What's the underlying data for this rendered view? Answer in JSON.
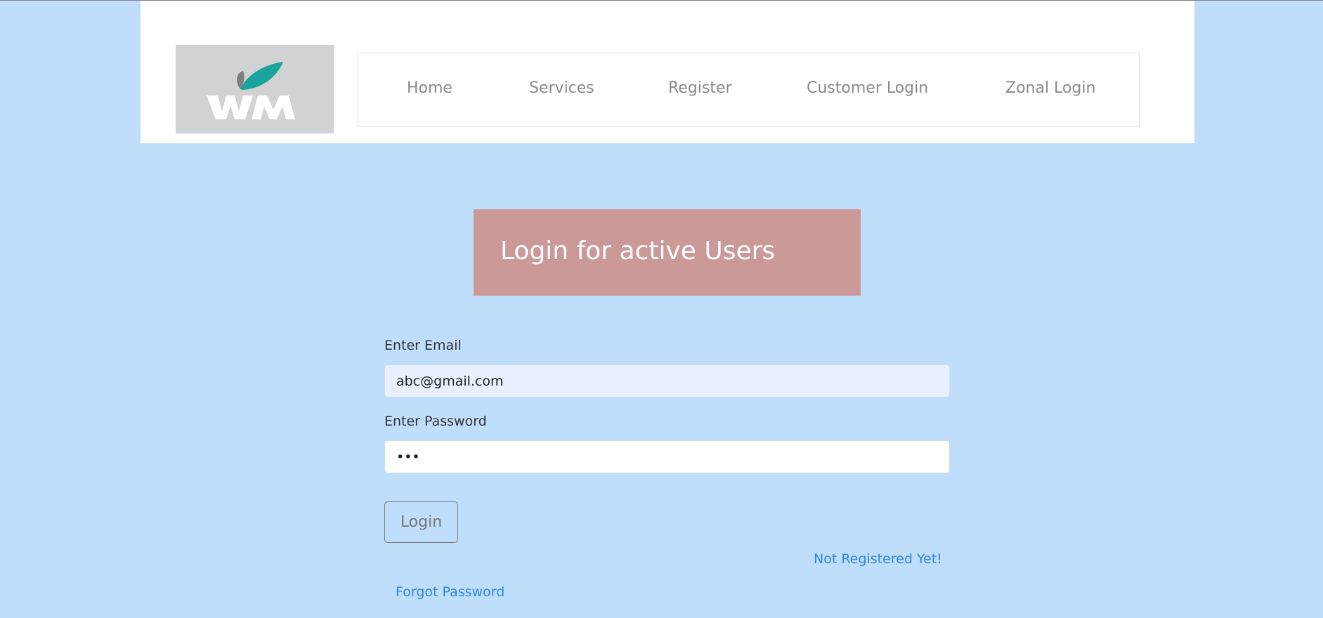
{
  "header": {
    "logo_text": "WM",
    "nav": [
      {
        "label": "Home"
      },
      {
        "label": "Services"
      },
      {
        "label": "Register"
      },
      {
        "label": "Customer Login"
      },
      {
        "label": "Zonal Login"
      }
    ]
  },
  "banner": {
    "title": "Login for active Users"
  },
  "form": {
    "email_label": "Enter Email",
    "email_value": "abc@gmail.com",
    "password_label": "Enter Password",
    "password_value": "abc",
    "login_label": "Login",
    "not_registered_label": "Not Registered Yet!",
    "forgot_password_label": "Forgot Password"
  },
  "colors": {
    "page_bg": "#bfdefc",
    "banner_bg": "#cc9999",
    "link": "#2f86e0",
    "logo_bg": "#d1d2d4",
    "leaf_teal": "#1aa39a",
    "leaf_gray": "#7f7f7f"
  }
}
